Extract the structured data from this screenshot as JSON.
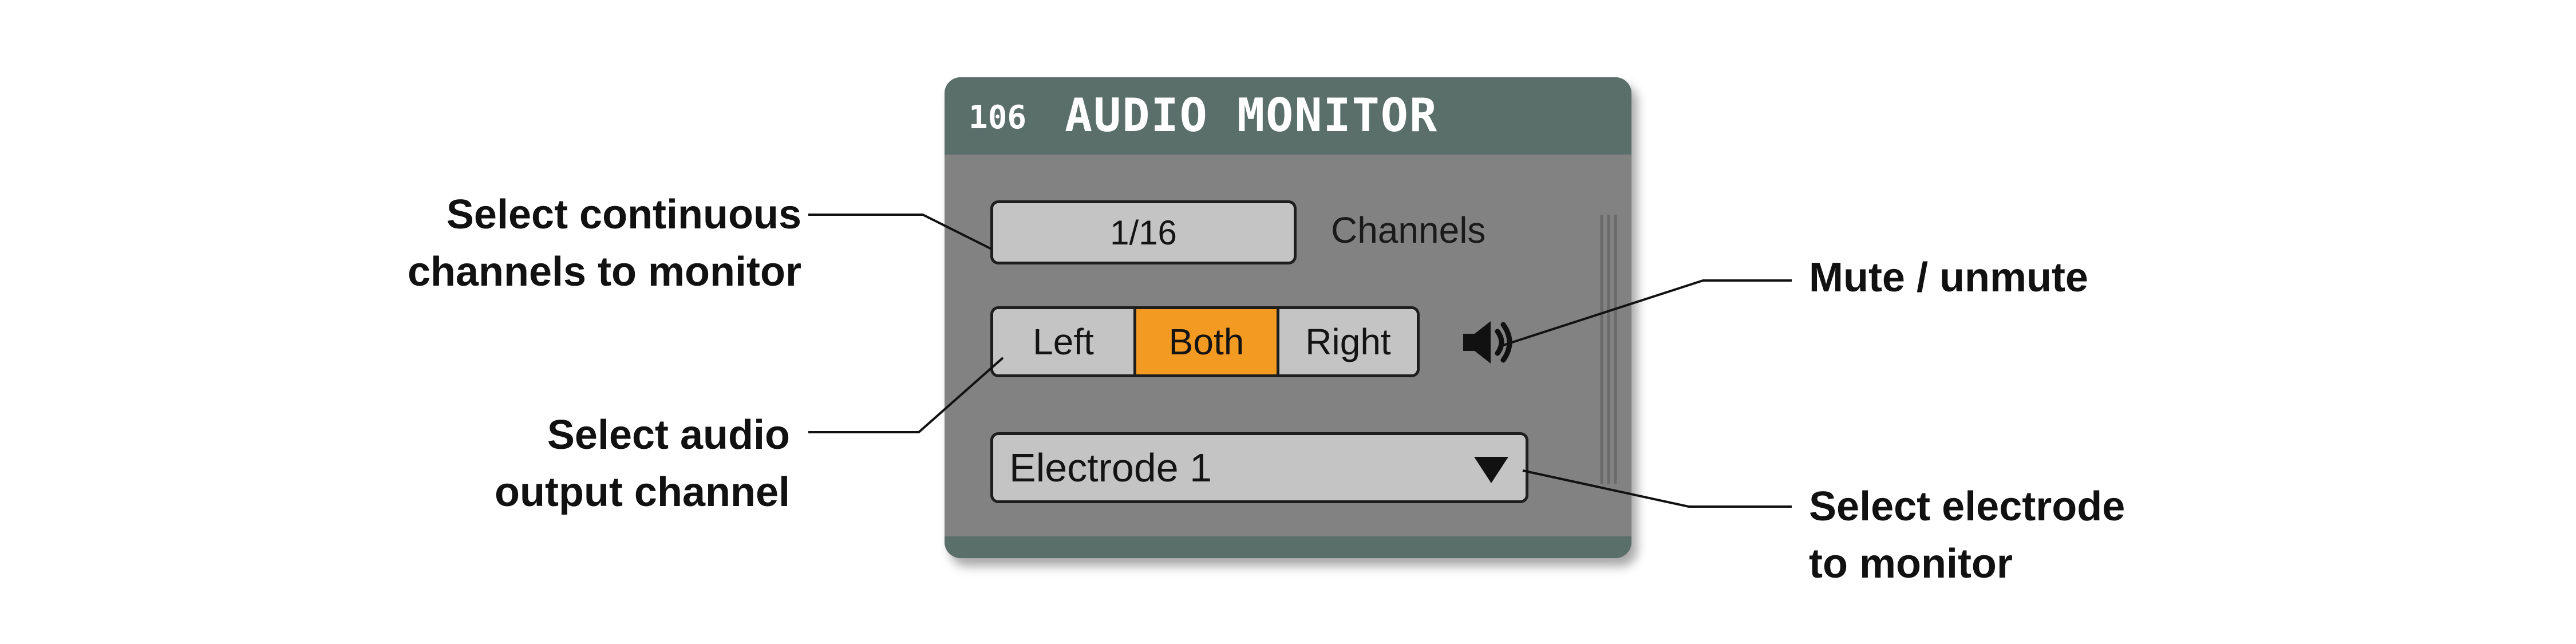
{
  "panel": {
    "id": "106",
    "title": "AUDIO MONITOR",
    "channels_button": "1/16",
    "channels_label": "Channels",
    "output_buttons": [
      {
        "label": "Left",
        "active": false
      },
      {
        "label": "Both",
        "active": true
      },
      {
        "label": "Right",
        "active": false
      }
    ],
    "mute_icon": "speaker-icon",
    "electrode_select": "Electrode 1",
    "dropdown_icon": "triangle-down-icon"
  },
  "callouts": {
    "channels": [
      "Select continuous",
      "channels to monitor"
    ],
    "output": [
      "Select audio",
      "output channel"
    ],
    "mute": [
      "Mute / unmute"
    ],
    "electrode": [
      "Select electrode",
      "to monitor"
    ]
  },
  "colors": {
    "header": "#5a6e6a",
    "panel_body": "#828282",
    "control": "#c4c4c4",
    "active": "#f39a22"
  }
}
